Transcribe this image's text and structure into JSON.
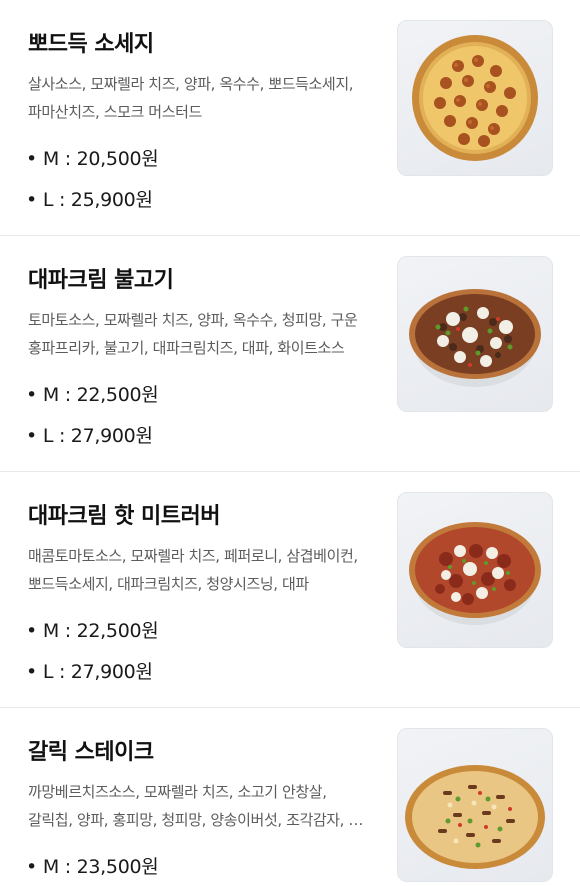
{
  "menu": [
    {
      "title": "뽀드득 소세지",
      "desc_line1": "살사소스, 모짜렐라 치즈, 양파, 옥수수, 뽀드득소세지,",
      "desc_line2": "파마산치즈, 스모크 머스터드",
      "price_m": "M : 20,500원",
      "price_l": "L : 25,900원",
      "image_icon": "sausage-pizza-icon"
    },
    {
      "title": "대파크림 불고기",
      "desc_line1": "토마토소스, 모짜렐라 치즈, 양파, 옥수수, 청피망, 구운",
      "desc_line2": "홍파프리카, 불고기, 대파크림치즈, 대파, 화이트소스",
      "price_m": "M : 22,500원",
      "price_l": "L : 27,900원",
      "image_icon": "bulgogi-pizza-icon"
    },
    {
      "title": "대파크림 핫 미트러버",
      "desc_line1": "매콤토마토소스, 모짜렐라 치즈, 페퍼로니, 삼겹베이컨,",
      "desc_line2": "뽀드득소세지, 대파크림치즈, 청양시즈닝, 대파",
      "price_m": "M : 22,500원",
      "price_l": "L : 27,900원",
      "image_icon": "meat-lover-pizza-icon"
    },
    {
      "title": "갈릭 스테이크",
      "desc_line1": "까망베르치즈소스, 모짜렐라 치즈, 소고기 안창살,",
      "desc_line2": "갈릭칩, 양파, 홍피망, 청피망, 양송이버섯, 조각감자, …",
      "price_m": "M : 23,500원",
      "price_l": "",
      "image_icon": "garlic-steak-pizza-icon"
    }
  ],
  "bullet": "•"
}
